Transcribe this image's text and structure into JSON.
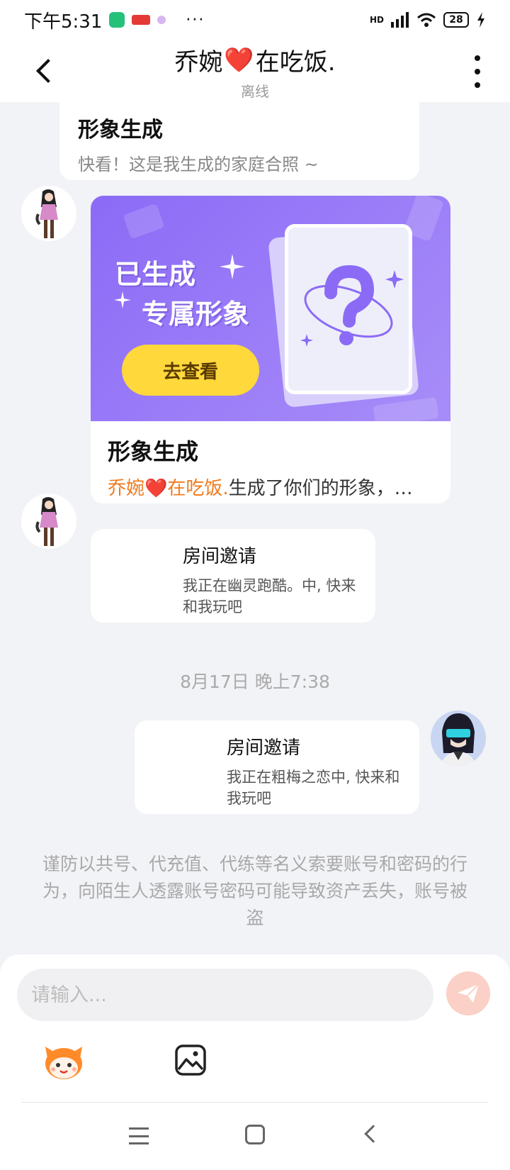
{
  "status_bar": {
    "time": "下午5:31",
    "network": "HD",
    "battery": "28",
    "more": "···"
  },
  "header": {
    "back_icon": "chevron-left-icon",
    "title_part1": "乔婉",
    "title_heart": "❤️",
    "title_part2": "在吃饭.",
    "subtitle": "离线",
    "more_icon": "more-vertical-icon"
  },
  "messages": {
    "top_card": {
      "title": "形象生成",
      "desc": "快看！这是我生成的家庭合照 ~"
    },
    "image_card": {
      "banner_line1": "已生成",
      "banner_line2": "专属形象",
      "button": "去查看",
      "title": "形象生成",
      "desc_highlight_name": "乔婉",
      "desc_highlight_heart": "❤️",
      "desc_highlight_rest": "在吃饭.",
      "desc_rest": "生成了你们的形象，…"
    },
    "invite1": {
      "title": "房间邀请",
      "desc": "我正在幽灵跑酷。中, 快来和我玩吧"
    },
    "timestamp": "8月17日 晚上7:38",
    "invite2": {
      "title": "房间邀请",
      "desc": "我正在粗梅之恋中, 快来和我玩吧"
    }
  },
  "warning": "谨防以共号、代充值、代练等名义索要账号和密码的行为，向陌生人透露账号密码可能导致资产丢失，账号被盗",
  "composer": {
    "placeholder": "请输入...",
    "send_icon": "paper-plane-icon",
    "emoji_icon": "mascot-emoji-icon",
    "image_icon": "image-icon"
  },
  "colors": {
    "accent_orange": "#f07a1e",
    "banner_purple": "#8b6bf6",
    "button_yellow": "#ffd83b",
    "send_disabled": "#fbd0c6"
  }
}
